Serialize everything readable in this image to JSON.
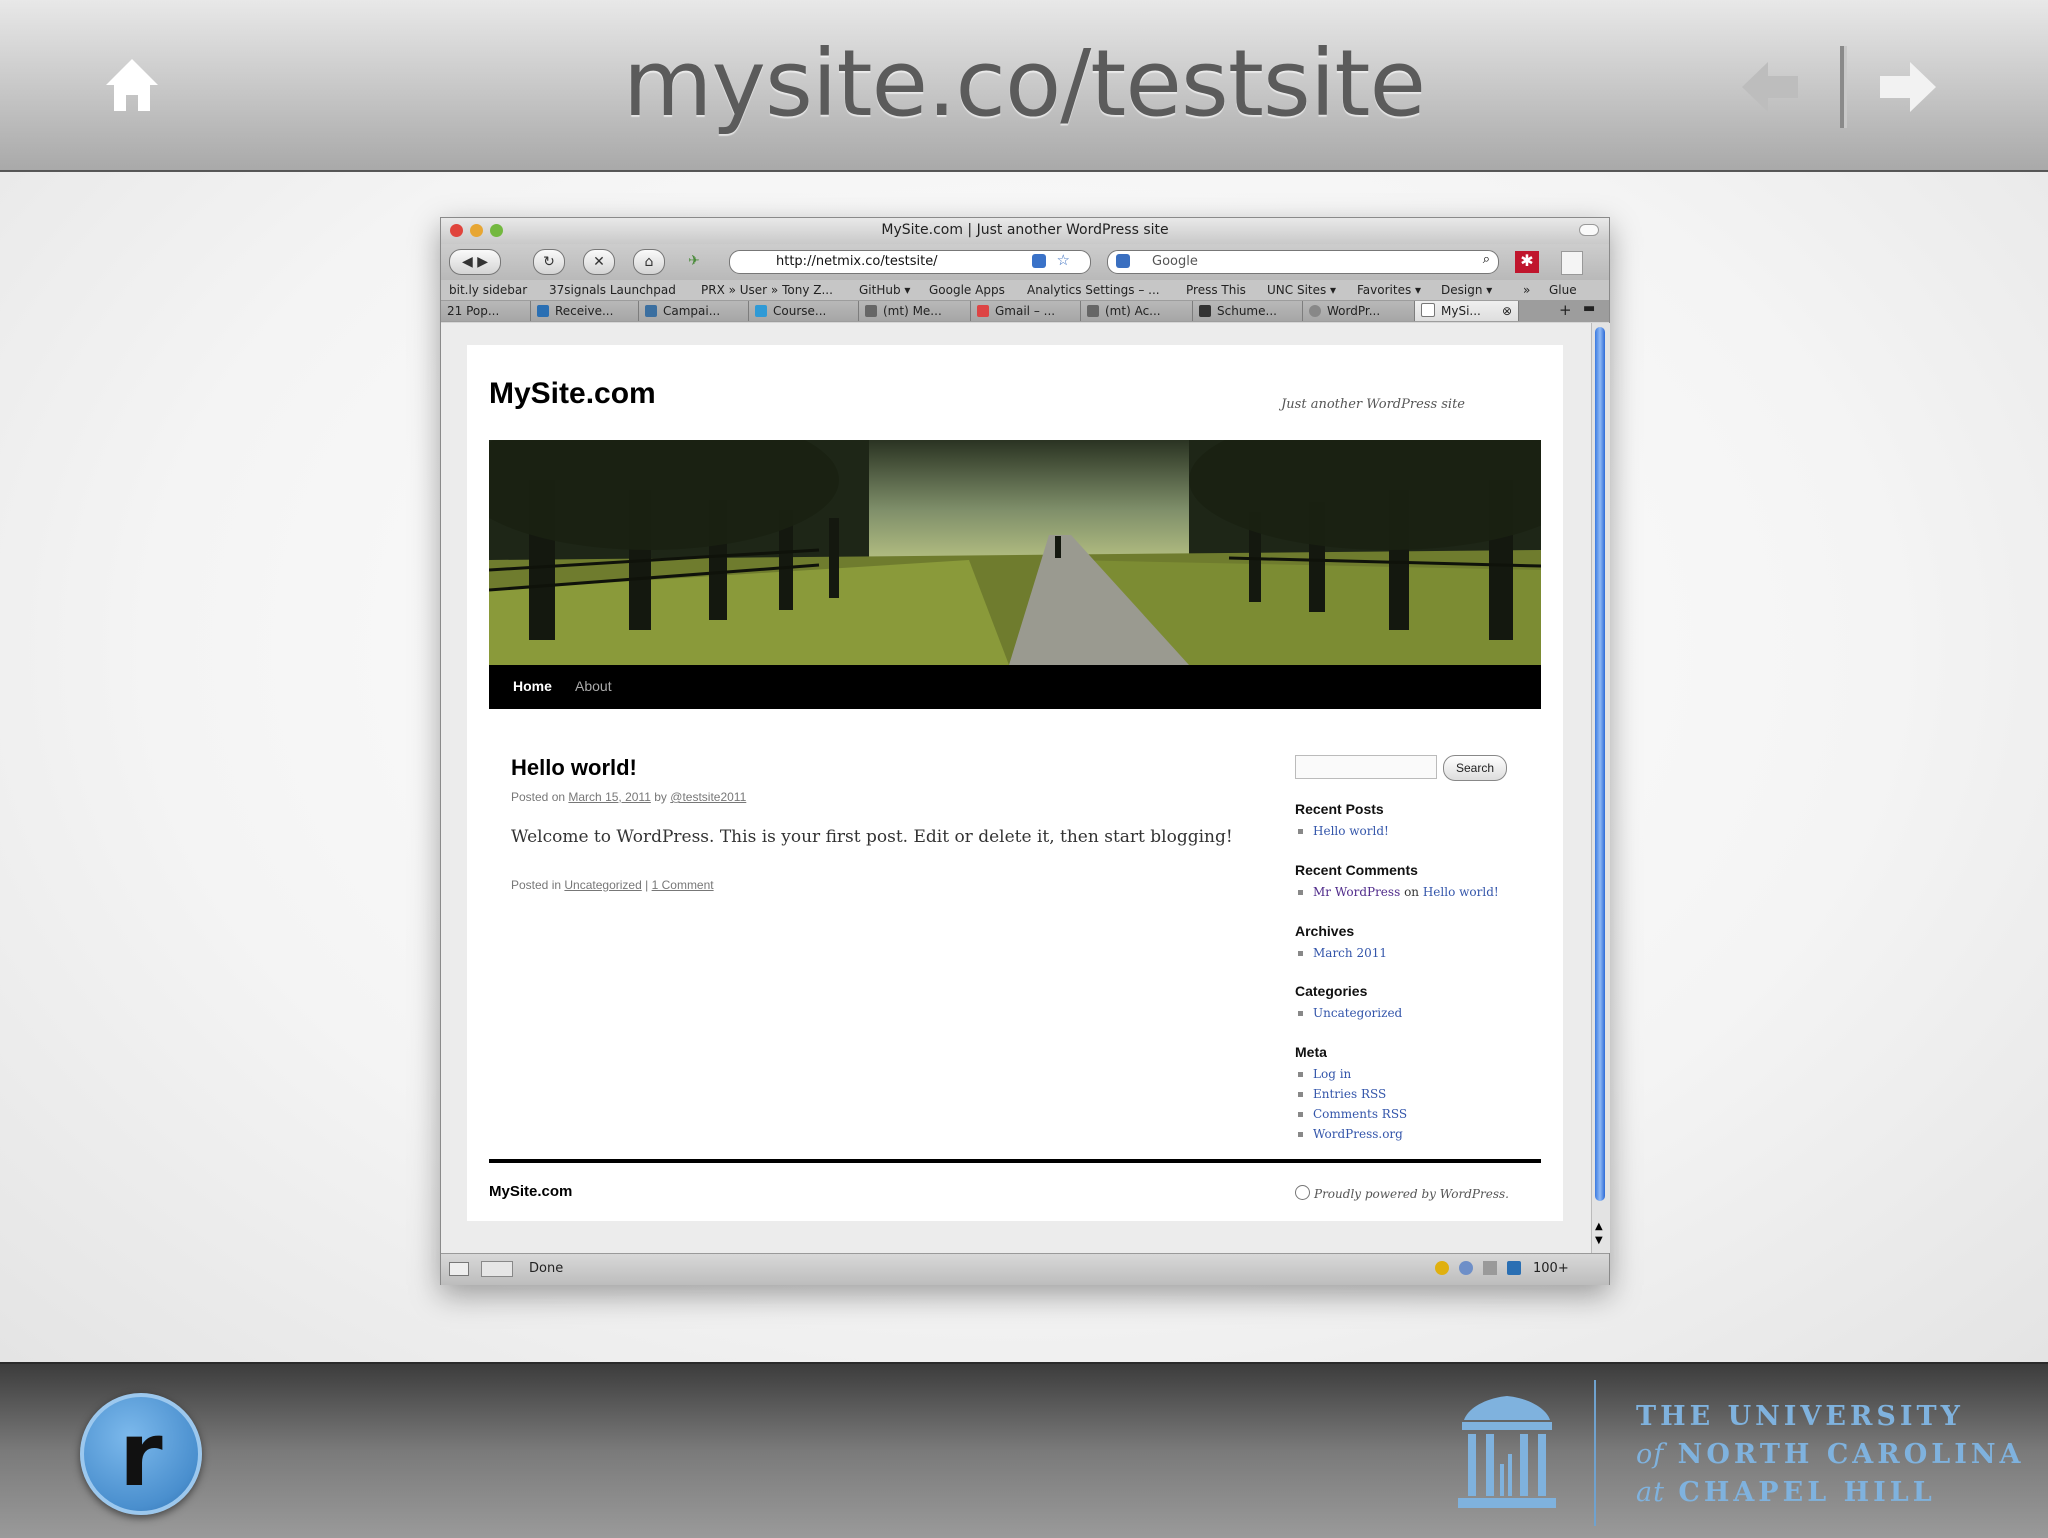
{
  "slide": {
    "title": "mysite.co/testsite",
    "icons": [
      "home-icon",
      "arrow-left-icon",
      "arrow-right-icon"
    ]
  },
  "browser": {
    "window_title": "MySite.com | Just another WordPress site",
    "url": "http://netmix.co/testsite/",
    "search_placeholder": "Google",
    "bookmarks": [
      "bit.ly sidebar",
      "37signals Launchpad",
      "PRX » User » Tony Z...",
      "GitHub ▾",
      "Google Apps",
      "Analytics Settings – ...",
      "Press This",
      "UNC Sites ▾",
      "Favorites ▾",
      "Design ▾",
      "»",
      "Glue"
    ],
    "tabs": [
      "21 Pop...",
      "Receive...",
      "Campai...",
      "Course...",
      "(mt) Me...",
      "Gmail – ...",
      "(mt) Ac...",
      "Schume...",
      "WordPr...",
      "MySi..."
    ],
    "status": "Done",
    "zoom": "100+"
  },
  "site": {
    "title": "MySite.com",
    "tagline": "Just another WordPress site",
    "nav": [
      "Home",
      "About"
    ],
    "post": {
      "title": "Hello world!",
      "posted_on": "Posted on",
      "date": "March 15, 2011",
      "by": "by",
      "author": "@testsite2011",
      "body": "Welcome to WordPress. This is your first post. Edit or delete it, then start blogging!",
      "posted_in": "Posted in",
      "category": "Uncategorized",
      "sep": "|",
      "comments": "1 Comment"
    },
    "search_button": "Search",
    "widgets": {
      "recent_posts": {
        "title": "Recent Posts",
        "items": [
          "Hello world!"
        ]
      },
      "recent_comments": {
        "title": "Recent Comments",
        "author": "Mr WordPress",
        "on": "on",
        "post": "Hello world!"
      },
      "archives": {
        "title": "Archives",
        "items": [
          "March 2011"
        ]
      },
      "categories": {
        "title": "Categories",
        "items": [
          "Uncategorized"
        ]
      },
      "meta": {
        "title": "Meta",
        "items": [
          "Log in",
          "Entries RSS",
          "Comments RSS",
          "WordPress.org"
        ]
      }
    },
    "footer_title": "MySite.com",
    "powered": "Proudly powered by WordPress."
  },
  "footer": {
    "logo_letter": "r",
    "university": [
      "THE UNIVERSITY",
      "of",
      "NORTH CAROLINA",
      "at",
      "CHAPEL HILL"
    ]
  },
  "colors": {
    "link": "#3355aa",
    "visited": "#4f2a8a",
    "unc_blue": "#7fb2de",
    "scroll_blue": "#3b7ae0"
  }
}
